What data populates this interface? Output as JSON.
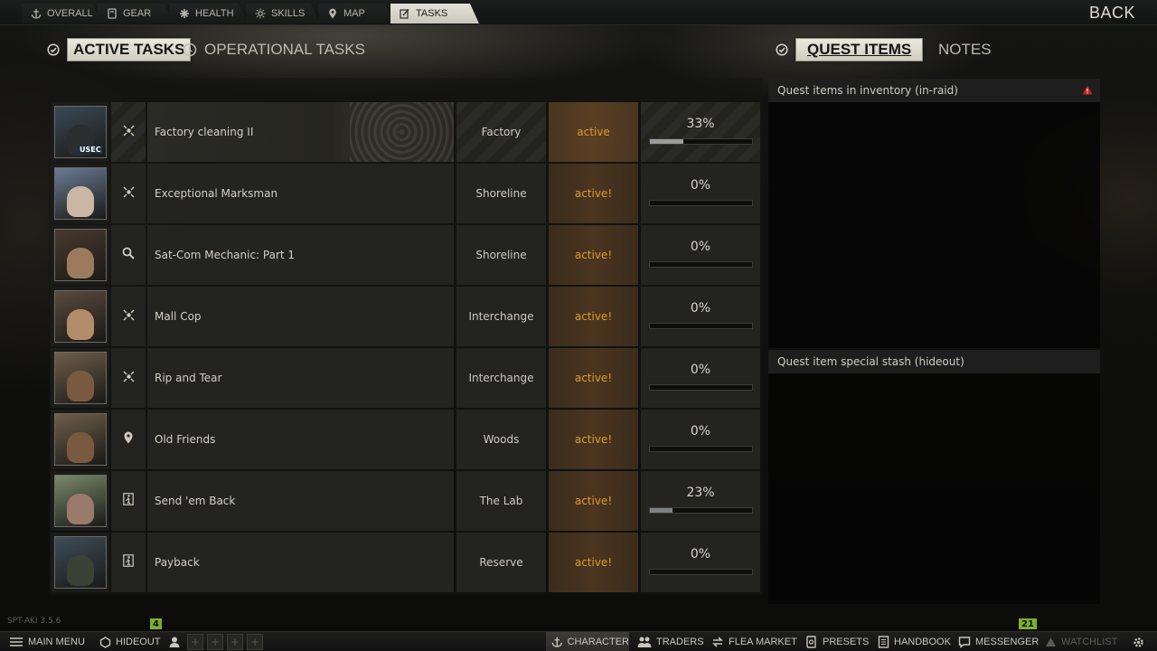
{
  "top_tabs": [
    {
      "label": "OVERALL",
      "icon": "anchor-icon"
    },
    {
      "label": "GEAR",
      "icon": "gear-icon"
    },
    {
      "label": "HEALTH",
      "icon": "health-icon"
    },
    {
      "label": "SKILLS",
      "icon": "skills-icon"
    },
    {
      "label": "MAP",
      "icon": "map-pin-icon"
    },
    {
      "label": "TASKS",
      "icon": "tasks-icon",
      "active": true
    }
  ],
  "back_label": "BACK",
  "sub_tabs": {
    "active_tasks": "ACTIVE TASKS",
    "operational_tasks": "OPERATIONAL TASKS",
    "quest_items": "QUEST ITEMS",
    "notes": "NOTES"
  },
  "tasks": [
    {
      "name": "Factory cleaning II",
      "location": "Factory",
      "status": "active",
      "progress_label": "33%",
      "progress": 0.33,
      "type_icon": "target-icon",
      "portrait_badge": "USEC",
      "highlight": true
    },
    {
      "name": "Exceptional Marksman",
      "location": "Shoreline",
      "status": "active!",
      "progress_label": "0%",
      "progress": 0,
      "type_icon": "target-icon"
    },
    {
      "name": "Sat-Com Mechanic: Part 1",
      "location": "Shoreline",
      "status": "active!",
      "progress_label": "0%",
      "progress": 0,
      "type_icon": "search-icon"
    },
    {
      "name": "Mall Cop",
      "location": "Interchange",
      "status": "active!",
      "progress_label": "0%",
      "progress": 0,
      "type_icon": "target-icon"
    },
    {
      "name": "Rip and Tear",
      "location": "Interchange",
      "status": "active!",
      "progress_label": "0%",
      "progress": 0,
      "type_icon": "target-icon"
    },
    {
      "name": "Old Friends",
      "location": "Woods",
      "status": "active!",
      "progress_label": "0%",
      "progress": 0,
      "type_icon": "map-pin-icon"
    },
    {
      "name": "Send 'em Back",
      "location": "The Lab",
      "status": "active!",
      "progress_label": "23%",
      "progress": 0.23,
      "type_icon": "exit-icon"
    },
    {
      "name": "Payback",
      "location": "Reserve",
      "status": "active!",
      "progress_label": "0%",
      "progress": 0,
      "type_icon": "exit-icon"
    }
  ],
  "side_panel": {
    "inventory_title": "Quest items in inventory (in-raid)",
    "stash_title": "Quest item special stash (hideout)"
  },
  "version": "SPT-AKI 3.5.6",
  "bottom_bar": {
    "main_menu": "MAIN MENU",
    "hideout": "HIDEOUT",
    "hideout_badge": "4",
    "character": "CHARACTER",
    "traders": "TRADERS",
    "flea_market": "FLEA MARKET",
    "presets": "PRESETS",
    "handbook": "HANDBOOK",
    "messenger": "MESSENGER",
    "messenger_badge": "21",
    "watchlist": "WATCHLIST"
  },
  "colors": {
    "status_active": "#e09a2e",
    "badge_green": "#7fb02a",
    "warning_red": "#c0261c"
  }
}
